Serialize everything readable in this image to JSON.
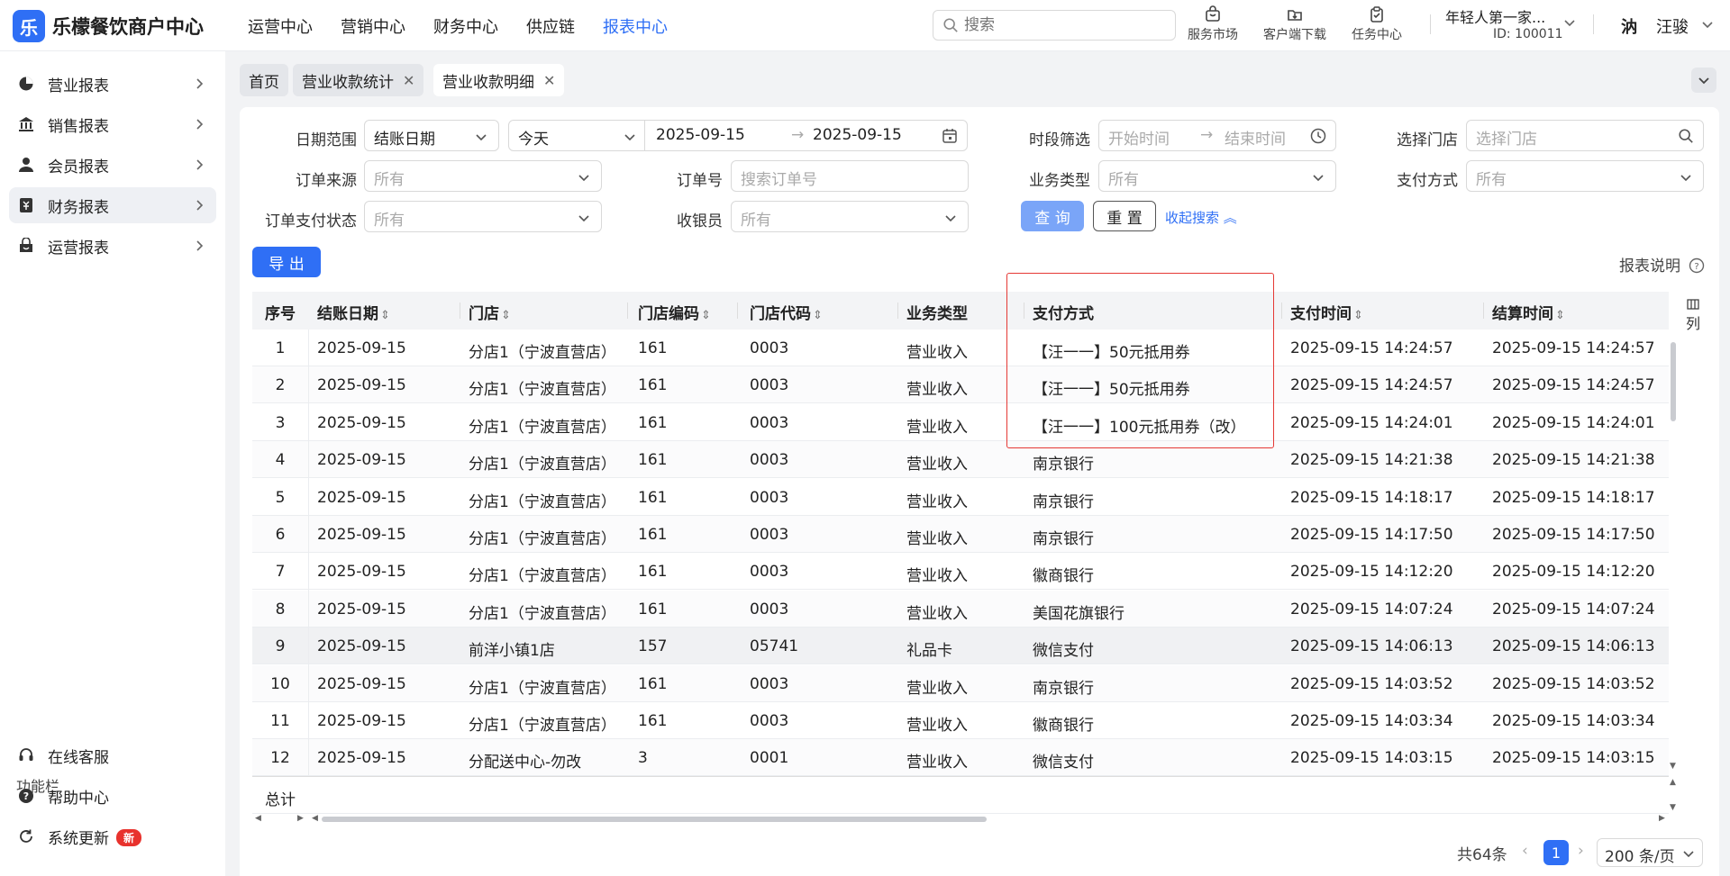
{
  "app": {
    "logo_glyph": "乐",
    "brand": "乐檬餐饮商户中心"
  },
  "nav": [
    {
      "label": "运营中心",
      "active": false
    },
    {
      "label": "营销中心",
      "active": false
    },
    {
      "label": "财务中心",
      "active": false
    },
    {
      "label": "供应链",
      "active": false
    },
    {
      "label": "报表中心",
      "active": true
    }
  ],
  "search": {
    "placeholder": "搜索"
  },
  "tools": {
    "market": "服务市场",
    "download": "客户端下载",
    "tasks": "任务中心"
  },
  "store": {
    "name": "年轻人第一家...",
    "id": "ID: 100011"
  },
  "user": {
    "avatar_text": "汭",
    "name": "汪骏"
  },
  "sidebar": {
    "items": [
      {
        "label": "营业报表",
        "icon": "chart-pie-icon"
      },
      {
        "label": "销售报表",
        "icon": "bank-icon"
      },
      {
        "label": "会员报表",
        "icon": "user-icon"
      },
      {
        "label": "财务报表",
        "icon": "receipt-icon",
        "active": true
      },
      {
        "label": "运营报表",
        "icon": "shop-icon"
      }
    ],
    "func_title": "功能栏",
    "func_items": [
      {
        "label": "在线客服",
        "icon": "headset-icon"
      },
      {
        "label": "帮助中心",
        "icon": "help-icon"
      },
      {
        "label": "系统更新",
        "icon": "refresh-icon",
        "badge": "新"
      }
    ]
  },
  "tabs": [
    {
      "label": "首页"
    },
    {
      "label": "营业收款统计",
      "closable": true
    },
    {
      "label": "营业收款明细",
      "closable": true,
      "active": true
    }
  ],
  "filters": {
    "date_range_label": "日期范围",
    "date_type": "结账日期",
    "date_preset": "今天",
    "date_start": "2025-09-15",
    "date_end": "2025-09-15",
    "time_label": "时段筛选",
    "time_start_ph": "开始时间",
    "time_end_ph": "结束时间",
    "store_label": "选择门店",
    "store_ph": "选择门店",
    "source_label": "订单来源",
    "source_val": "所有",
    "order_no_label": "订单号",
    "order_no_ph": "搜索订单号",
    "biz_type_label": "业务类型",
    "biz_type_val": "所有",
    "pay_method_label": "支付方式",
    "pay_method_val": "所有",
    "pay_status_label": "订单支付状态",
    "pay_status_val": "所有",
    "cashier_label": "收银员",
    "cashier_val": "所有",
    "query_btn": "查 询",
    "reset_btn": "重 置",
    "collapse_link": "收起搜索"
  },
  "export_btn": "导 出",
  "report_help": "报表说明",
  "table": {
    "headers": [
      "序号",
      "结账日期",
      "门店",
      "门店编码",
      "门店代码",
      "业务类型",
      "支付方式",
      "支付时间",
      "结算时间"
    ],
    "rows": [
      [
        "1",
        "2025-09-15",
        "分店1（宁波直营店）",
        "161",
        "0003",
        "营业收入",
        "【汪一一】50元抵用券",
        "2025-09-15 14:24:57",
        "2025-09-15 14:24:57"
      ],
      [
        "2",
        "2025-09-15",
        "分店1（宁波直营店）",
        "161",
        "0003",
        "营业收入",
        "【汪一一】50元抵用券",
        "2025-09-15 14:24:57",
        "2025-09-15 14:24:57"
      ],
      [
        "3",
        "2025-09-15",
        "分店1（宁波直营店）",
        "161",
        "0003",
        "营业收入",
        "【汪一一】100元抵用券（改）",
        "2025-09-15 14:24:01",
        "2025-09-15 14:24:01"
      ],
      [
        "4",
        "2025-09-15",
        "分店1（宁波直营店）",
        "161",
        "0003",
        "营业收入",
        "南京银行",
        "2025-09-15 14:21:38",
        "2025-09-15 14:21:38"
      ],
      [
        "5",
        "2025-09-15",
        "分店1（宁波直营店）",
        "161",
        "0003",
        "营业收入",
        "南京银行",
        "2025-09-15 14:18:17",
        "2025-09-15 14:18:17"
      ],
      [
        "6",
        "2025-09-15",
        "分店1（宁波直营店）",
        "161",
        "0003",
        "营业收入",
        "南京银行",
        "2025-09-15 14:17:50",
        "2025-09-15 14:17:50"
      ],
      [
        "7",
        "2025-09-15",
        "分店1（宁波直营店）",
        "161",
        "0003",
        "营业收入",
        "徽商银行",
        "2025-09-15 14:12:20",
        "2025-09-15 14:12:20"
      ],
      [
        "8",
        "2025-09-15",
        "分店1（宁波直营店）",
        "161",
        "0003",
        "营业收入",
        "美国花旗银行",
        "2025-09-15 14:07:24",
        "2025-09-15 14:07:24"
      ],
      [
        "9",
        "2025-09-15",
        "前洋小镇1店",
        "157",
        "05741",
        "礼品卡",
        "微信支付",
        "2025-09-15 14:06:13",
        "2025-09-15 14:06:13"
      ],
      [
        "10",
        "2025-09-15",
        "分店1（宁波直营店）",
        "161",
        "0003",
        "营业收入",
        "南京银行",
        "2025-09-15 14:03:52",
        "2025-09-15 14:03:52"
      ],
      [
        "11",
        "2025-09-15",
        "分店1（宁波直营店）",
        "161",
        "0003",
        "营业收入",
        "徽商银行",
        "2025-09-15 14:03:34",
        "2025-09-15 14:03:34"
      ],
      [
        "12",
        "2025-09-15",
        "分配送中心-勿改",
        "3",
        "0001",
        "营业收入",
        "微信支付",
        "2025-09-15 14:03:15",
        "2025-09-15 14:03:15"
      ]
    ],
    "total_label": "总计",
    "column_setting": "列"
  },
  "pagination": {
    "total": "共64条",
    "current": "1",
    "page_size": "200 条/页"
  }
}
